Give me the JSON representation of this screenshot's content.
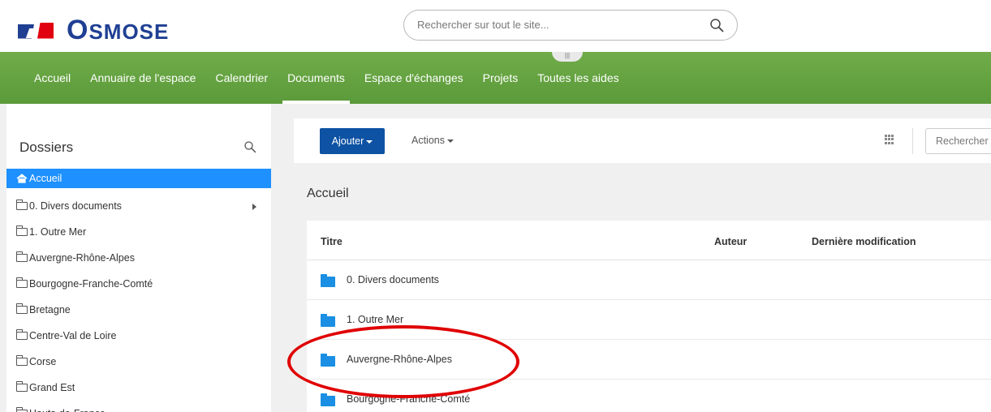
{
  "header": {
    "logo_text": "OSMOSE",
    "logo_first": "O",
    "logo_rest": "SMOSE",
    "search_placeholder": "Rechercher sur tout le site..."
  },
  "nav": {
    "items": [
      {
        "label": "Accueil"
      },
      {
        "label": "Annuaire de l'espace"
      },
      {
        "label": "Calendrier"
      },
      {
        "label": "Documents",
        "active": true
      },
      {
        "label": "Espace d'échanges"
      },
      {
        "label": "Projets"
      },
      {
        "label": "Toutes les aides"
      }
    ]
  },
  "sidebar": {
    "title": "Dossiers",
    "items": [
      {
        "label": "Accueil",
        "active": true,
        "icon": "home-icon"
      },
      {
        "label": "0. Divers documents",
        "icon": "folder-icon",
        "has_children": true
      },
      {
        "label": "1. Outre Mer",
        "icon": "folder-icon"
      },
      {
        "label": "Auvergne-Rhône-Alpes",
        "icon": "folder-icon"
      },
      {
        "label": "Bourgogne-Franche-Comté",
        "icon": "folder-icon"
      },
      {
        "label": "Bretagne",
        "icon": "folder-icon"
      },
      {
        "label": "Centre-Val de Loire",
        "icon": "folder-icon"
      },
      {
        "label": "Corse",
        "icon": "folder-icon"
      },
      {
        "label": "Grand Est",
        "icon": "folder-icon"
      },
      {
        "label": "Hauts-de-France",
        "icon": "folder-icon"
      }
    ]
  },
  "toolbar": {
    "add_label": "Ajouter",
    "actions_label": "Actions",
    "search_placeholder": "Rechercher"
  },
  "main": {
    "title": "Accueil",
    "columns": {
      "title": "Titre",
      "author": "Auteur",
      "modified": "Dernière modification"
    },
    "rows": [
      {
        "name": "0. Divers documents"
      },
      {
        "name": "1. Outre Mer"
      },
      {
        "name": "Auvergne-Rhône-Alpes"
      },
      {
        "name": "Bourgogne-Franche-Comté"
      }
    ]
  },
  "colors": {
    "brand_blue": "#1f3f93",
    "nav_green": "#5b9a3a",
    "active_blue": "#1e90ff",
    "button_blue": "#0d52a3",
    "folder_blue": "#1a8fe3",
    "highlight_red": "#e00000"
  }
}
